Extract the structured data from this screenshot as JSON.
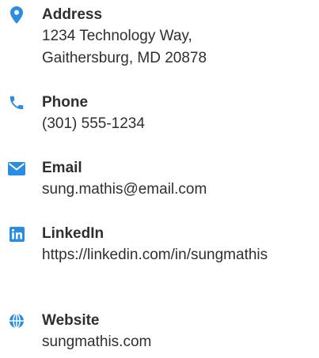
{
  "accent_color": "#2b8de0",
  "contacts": {
    "address": {
      "icon": "location-pin-icon",
      "label": "Address",
      "value": "1234 Technology Way,\nGaithersburg, MD 20878"
    },
    "phone": {
      "icon": "phone-icon",
      "label": "Phone",
      "value": "(301) 555-1234"
    },
    "email": {
      "icon": "envelope-icon",
      "label": "Email",
      "value": "sung.mathis@email.com"
    },
    "linkedin": {
      "icon": "linkedin-icon",
      "label": "LinkedIn",
      "value": "https://linkedin.com/in/sungmathis"
    },
    "website": {
      "icon": "globe-icon",
      "label": "Website",
      "value": "sungmathis.com"
    }
  }
}
